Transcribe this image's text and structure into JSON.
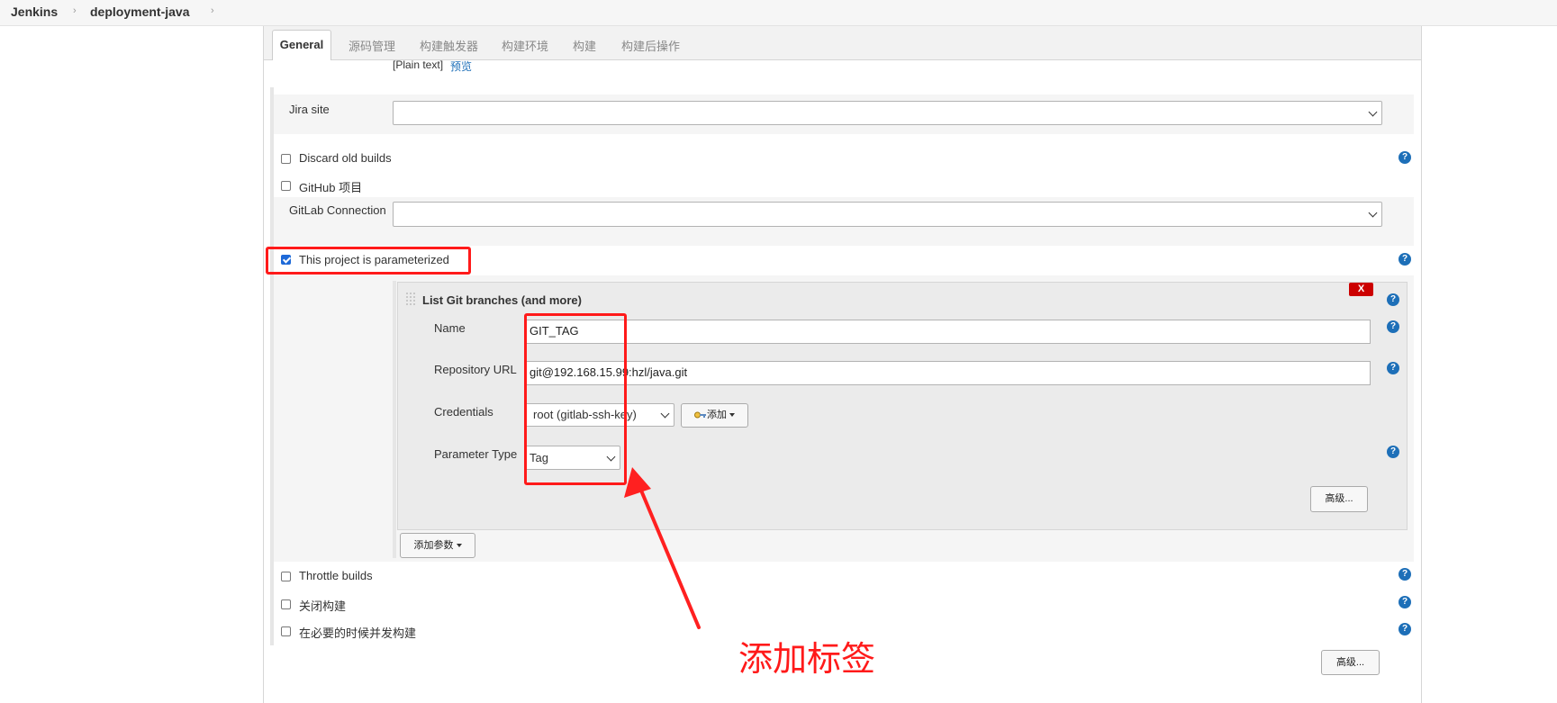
{
  "breadcrumb": {
    "root": "Jenkins",
    "job": "deployment-java"
  },
  "tabs": [
    "General",
    "源码管理",
    "构建触发器",
    "构建环境",
    "构建",
    "构建后操作"
  ],
  "description": {
    "format_text": "[Plain text]",
    "preview_link": "预览"
  },
  "fields": {
    "jira_site": "Jira site",
    "discard_old_builds": "Discard old builds",
    "github_project": "GitHub 项目",
    "gitlab_connection": "GitLab Connection",
    "parameterized": "This project is parameterized",
    "throttle_builds": "Throttle builds",
    "disable_build": "关闭构建",
    "concurrent_build": "在必要的时候并发构建"
  },
  "parameter": {
    "title": "List Git branches (and more)",
    "delete_label": "X",
    "name_label": "Name",
    "name_value": "GIT_TAG",
    "repo_label": "Repository URL",
    "repo_value": "git@192.168.15.99:hzl/java.git",
    "credentials_label": "Credentials",
    "credentials_value": "root (gitlab-ssh-key)",
    "add_credentials_label": "添加",
    "param_type_label": "Parameter Type",
    "param_type_value": "Tag",
    "advanced_label": "高级..."
  },
  "add_param_label": "添加参数",
  "bottom_advanced_label": "高级...",
  "help_glyph": "?",
  "annotation_text": "添加标签",
  "colors": {
    "highlight": "#ff1a1a",
    "help": "#1d6fb8",
    "delete": "#cc0000",
    "link": "#1d6fb8"
  },
  "icons": [
    "key-icon",
    "help-icon",
    "drag-handle-icon",
    "chevron-down-icon"
  ]
}
